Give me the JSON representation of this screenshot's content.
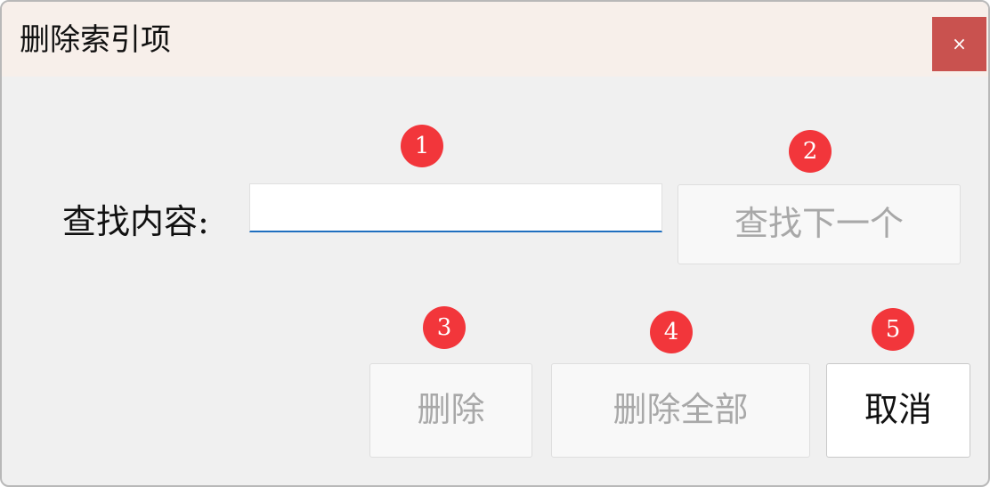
{
  "window": {
    "title": "删除索引项",
    "close_label": "×"
  },
  "form": {
    "find_label": "查找内容:",
    "find_input": {
      "value": "",
      "placeholder": ""
    }
  },
  "buttons": {
    "find_next": "查找下一个",
    "delete": "删除",
    "delete_all": "删除全部",
    "cancel": "取消"
  },
  "markers": [
    "1",
    "2",
    "3",
    "4",
    "5"
  ],
  "colors": {
    "titlebar_bg": "#f7efea",
    "close_bg": "#c9524f",
    "marker_red": "#f2363b",
    "input_underline": "#1f6fbf"
  }
}
